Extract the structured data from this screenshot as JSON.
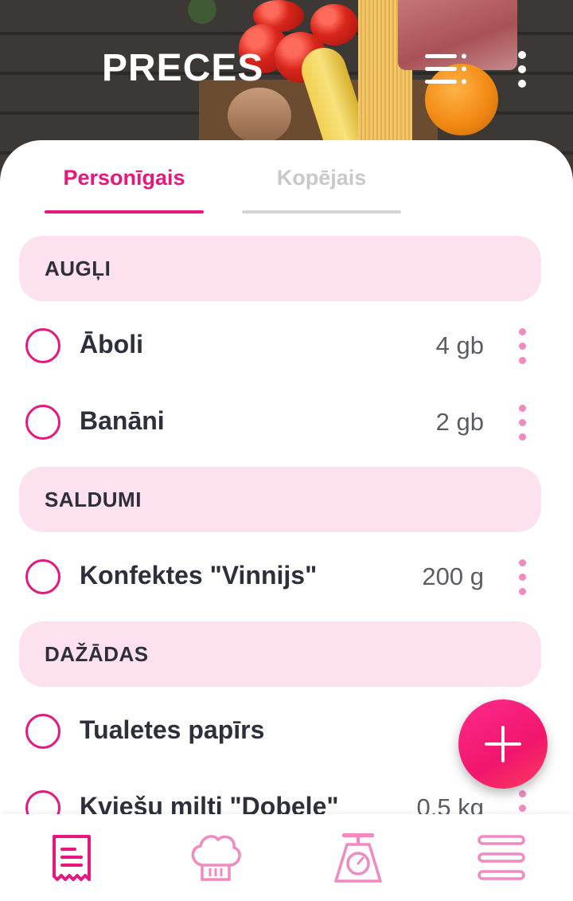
{
  "header": {
    "title": "PRECES"
  },
  "tabs": [
    {
      "label": "Personīgais",
      "active": true
    },
    {
      "label": "Kopējais",
      "active": false
    }
  ],
  "sections": [
    {
      "title": "AUGĻI",
      "items": [
        {
          "name": "Āboli",
          "qty": "4 gb"
        },
        {
          "name": "Banāni",
          "qty": "2 gb"
        }
      ]
    },
    {
      "title": "SALDUMI",
      "items": [
        {
          "name": "Konfektes \"Vinnijs\"",
          "qty": "200 g"
        }
      ]
    },
    {
      "title": "DAŽĀDAS",
      "items": [
        {
          "name": "Tualetes papīrs",
          "qty": ""
        },
        {
          "name": "Kviešu milti \"Dobele\"",
          "qty": "0,5 kg"
        }
      ]
    }
  ],
  "bottom_nav": [
    {
      "icon": "receipt-icon",
      "active": true
    },
    {
      "icon": "chef-hat-icon",
      "active": false
    },
    {
      "icon": "kitchen-scale-icon",
      "active": false
    },
    {
      "icon": "menu-icon",
      "active": false
    }
  ],
  "colors": {
    "accent": "#e8177f",
    "section_bg": "#fde1ef",
    "text": "#2d2f3a",
    "inactive_tab": "#c9c9cc",
    "nav_icon": "#f08ac0"
  }
}
